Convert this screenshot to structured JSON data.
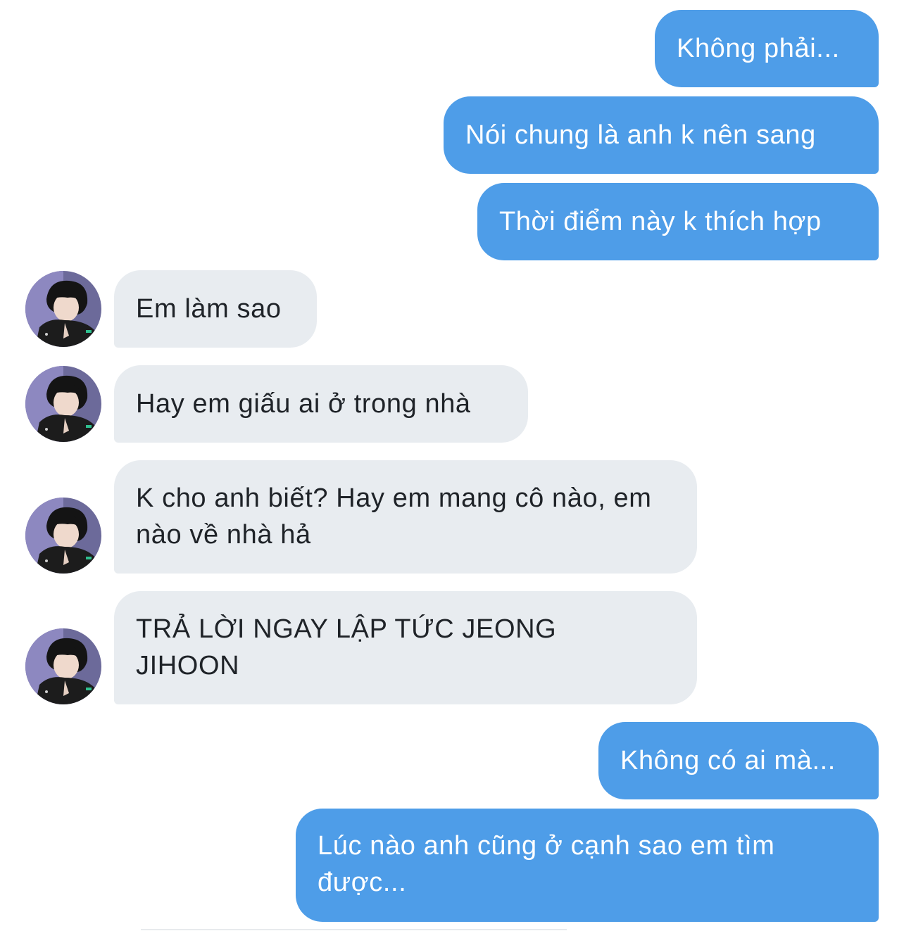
{
  "conversation": {
    "messages": [
      {
        "direction": "outgoing",
        "text": "Không phải..."
      },
      {
        "direction": "outgoing",
        "text": "Nói chung là anh k nên sang"
      },
      {
        "direction": "outgoing",
        "text": "Thời điểm này k thích hợp"
      },
      {
        "direction": "incoming",
        "text": "Em làm sao"
      },
      {
        "direction": "incoming",
        "text": "Hay em giấu ai ở trong nhà"
      },
      {
        "direction": "incoming",
        "text": "K cho anh biết? Hay em mang cô nào, em nào về nhà hả"
      },
      {
        "direction": "incoming",
        "text": "TRẢ LỜI NGAY LẬP TỨC JEONG JIHOON"
      },
      {
        "direction": "outgoing",
        "text": "Không có ai mà..."
      },
      {
        "direction": "outgoing",
        "text": "Lúc nào anh cũng ở cạnh sao em tìm được..."
      }
    ]
  },
  "colors": {
    "outgoing_bubble": "#4e9de8",
    "incoming_bubble": "#e8ecf0",
    "outgoing_text": "#ffffff",
    "incoming_text": "#1f2328"
  }
}
